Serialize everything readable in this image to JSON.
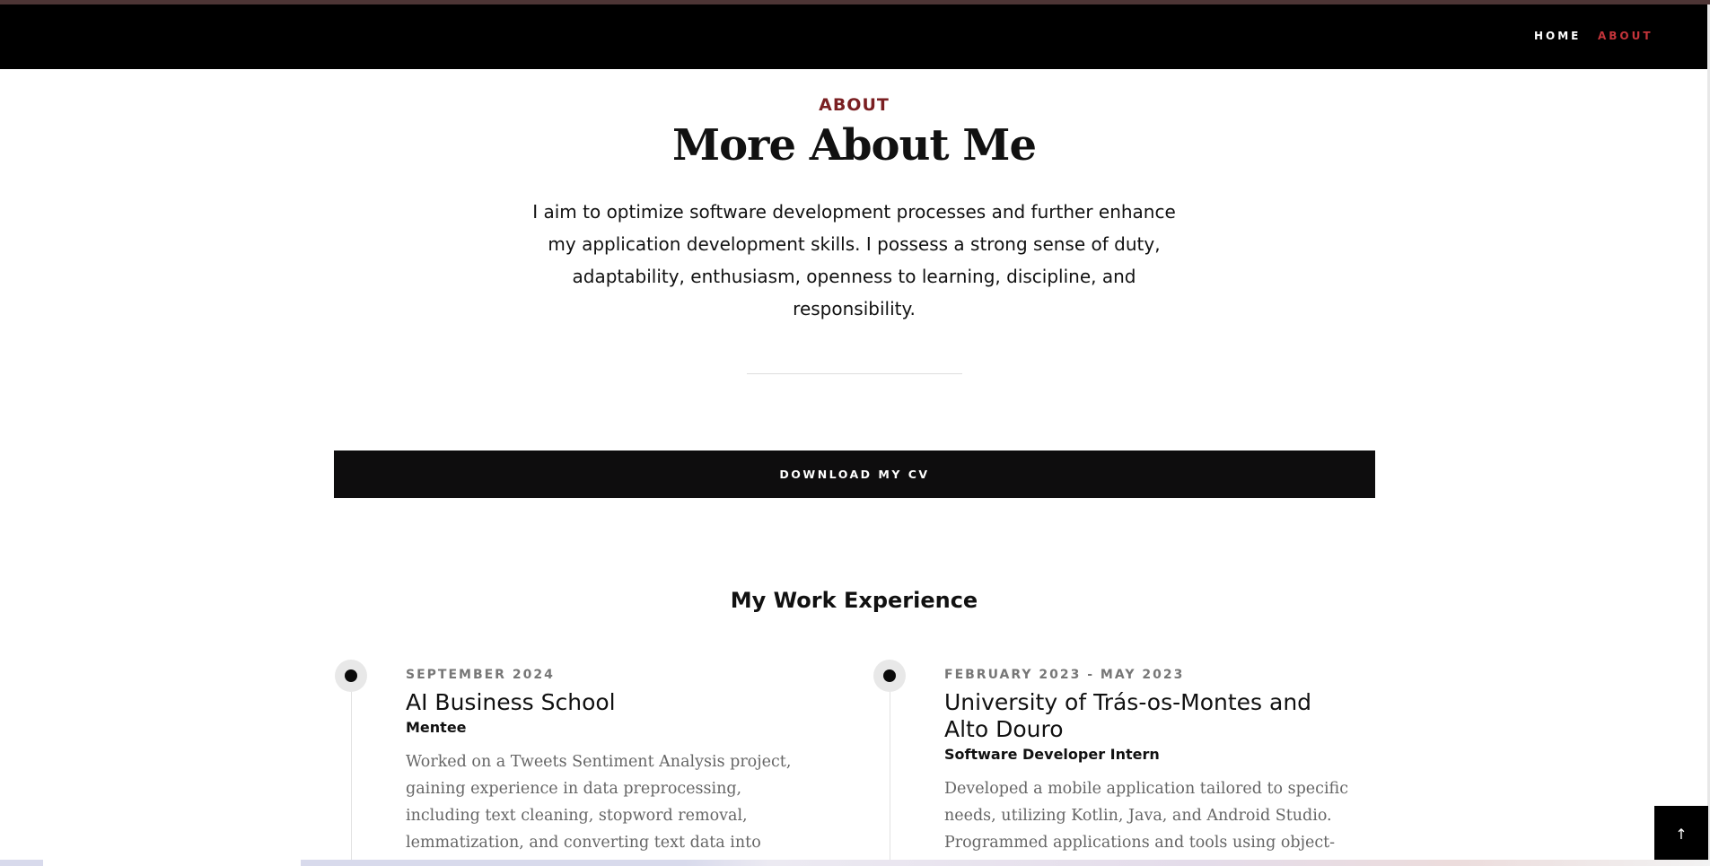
{
  "nav": {
    "items": [
      {
        "label": "HOME",
        "active": false
      },
      {
        "label": "ABOUT",
        "active": true
      }
    ],
    "active_color": "#c4343a"
  },
  "about": {
    "eyebrow": "ABOUT",
    "title": "More About Me",
    "lead": "I aim to optimize software development processes and further enhance my application development skills. I possess a strong sense of duty, adaptability, enthusiasm, openness to learning, discipline, and responsibility.",
    "cv_button": "DOWNLOAD MY CV"
  },
  "experience": {
    "heading": "My Work Experience",
    "items": [
      {
        "date": "SEPTEMBER 2024",
        "org": "AI Business School",
        "role": "Mentee",
        "desc": "Worked on a Tweets Sentiment Analysis project, gaining experience in data preprocessing, including text cleaning, stopword removal, lemmatization, and converting text data into numerical vectors using TF-"
      },
      {
        "date": "FEBRUARY 2023 - MAY 2023",
        "org": "University of Trás-os-Montes and Alto Douro",
        "role": "Software Developer Intern",
        "desc": "Developed a mobile application tailored to specific needs, utilizing Kotlin, Java, and Android Studio. Programmed applications and tools using object-"
      }
    ]
  },
  "back_to_top": {
    "icon": "arrow-up-icon",
    "glyph": "↑"
  }
}
